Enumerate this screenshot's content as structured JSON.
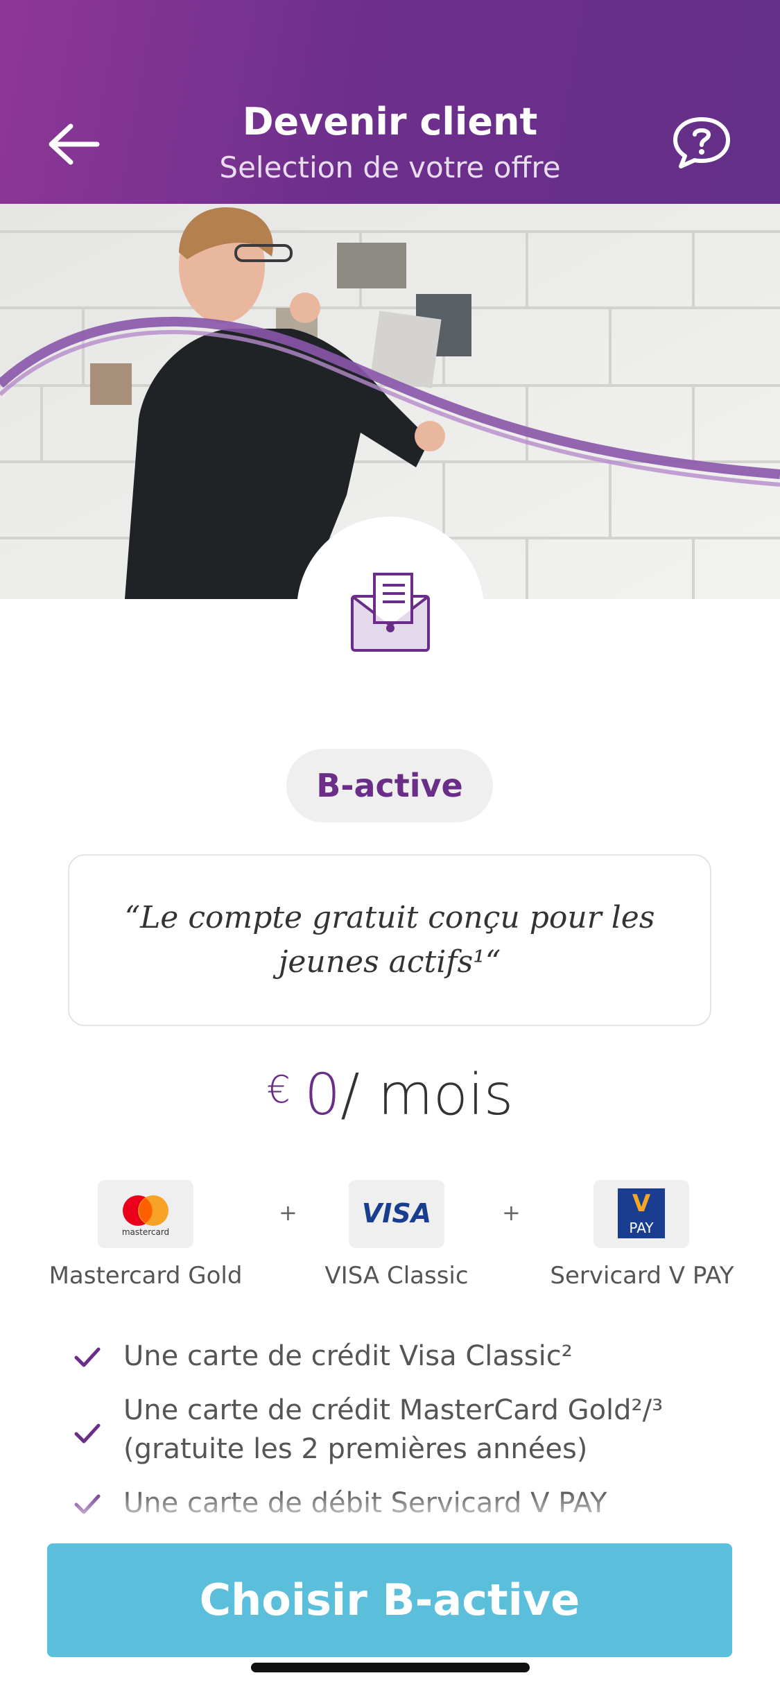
{
  "header": {
    "title": "Devenir client",
    "subtitle": "Selection de votre offre",
    "back_icon": "arrow-left-icon",
    "help_icon": "help-chat-icon",
    "gradient": [
      "#8e3796",
      "#632f87"
    ]
  },
  "hero": {
    "badge_icon": "briefcase-document-icon",
    "accent": "#6a2d88"
  },
  "offer": {
    "name": "B-active",
    "quote": "“Le compte gratuit conçu pour les jeunes actifs¹“",
    "price_currency": "€",
    "price_amount": "0",
    "price_period": "/ mois"
  },
  "cards": [
    {
      "label": "Mastercard Gold",
      "logo": "mastercard-logo-icon",
      "logo_text": "mastercard"
    },
    {
      "label": "VISA Classic",
      "logo": "visa-logo-icon",
      "logo_text": "VISA"
    },
    {
      "label": "Servicard V PAY",
      "logo": "vpay-logo-icon",
      "logo_text": "PAY"
    }
  ],
  "plus_sign": "+",
  "features": [
    "Une carte de crédit Visa Classic²",
    "Une carte de crédit MasterCard Gold²/³ (gratuite les 2 premières années)",
    "Une carte de débit Servicard V PAY"
  ],
  "cta": {
    "label": "Choisir B-active",
    "color": "#5bbfdb"
  }
}
